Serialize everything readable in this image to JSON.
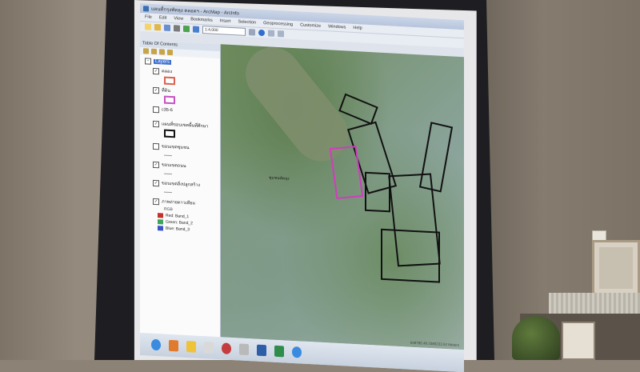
{
  "window": {
    "title": "แผนที่กรุงพัทลุง ตลอดฯ - ArcMap - ArcInfo"
  },
  "menu": [
    "File",
    "Edit",
    "View",
    "Bookmarks",
    "Insert",
    "Selection",
    "Geoprocessing",
    "Customize",
    "Windows",
    "Help"
  ],
  "toolbar": {
    "scale": "1:4,000"
  },
  "toc": {
    "title": "Table Of Contents",
    "root_label": "Layers",
    "layers": [
      {
        "label": "คลอง",
        "checked": true,
        "swatch": "#d9634f"
      },
      {
        "label": "ที่ดิน",
        "checked": true,
        "swatch": "#c653c0"
      },
      {
        "label": "c35-6",
        "checked": false,
        "swatch": ""
      },
      {
        "label": "แผนที่ขอบเขตพื้นที่ศึกษา",
        "checked": true,
        "swatch": "#111111"
      },
      {
        "label": "ขอบเขตชุมชน",
        "checked": false,
        "swatch": ""
      },
      {
        "label": "ขอบเขตถนน",
        "checked": true,
        "swatch": ""
      },
      {
        "label": "ขอบเขตสิ่งปลูกสร้าง",
        "checked": true,
        "swatch": ""
      },
      {
        "label": "ภาพถ่ายดาวเทียม",
        "checked": true,
        "swatch": ""
      }
    ],
    "rgb_label": "RGB",
    "bands": [
      {
        "label": "Red: Band_1",
        "color": "#c4302b"
      },
      {
        "label": "Green: Band_2",
        "color": "#3da55a"
      },
      {
        "label": "Blue: Band_3",
        "color": "#3b52c9"
      }
    ]
  },
  "map": {
    "label": "ชุมชนพัทลุง",
    "status": "648786.48  2380233.52 Meters"
  }
}
